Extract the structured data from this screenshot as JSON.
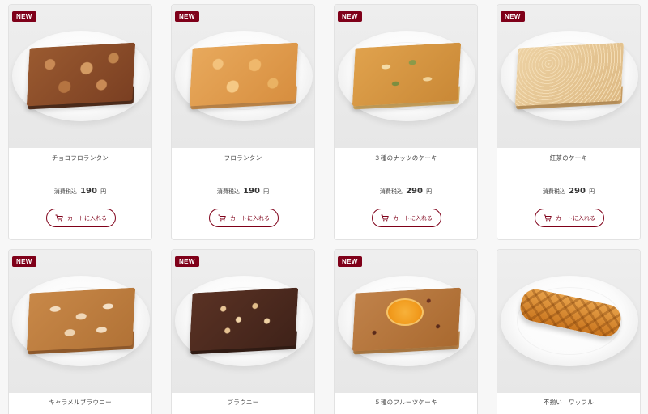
{
  "badge_label": "NEW",
  "price_prefix": "消費税込",
  "price_unit": "円",
  "cart_label": "カートに入れる",
  "accent_color": "#7f0019",
  "products": [
    {
      "name": "チョコフロランタン",
      "price": "190",
      "new": true
    },
    {
      "name": "フロランタン",
      "price": "190",
      "new": true
    },
    {
      "name": "３種のナッツのケーキ",
      "price": "290",
      "new": true
    },
    {
      "name": "紅茶のケーキ",
      "price": "290",
      "new": true
    },
    {
      "name": "キャラメルブラウニー",
      "new": true
    },
    {
      "name": "ブラウニー",
      "new": true
    },
    {
      "name": "５種のフルーツケーキ",
      "new": true
    },
    {
      "name": "不揃い　ワッフル",
      "new": false
    }
  ],
  "icons": {
    "cart": "cart-icon"
  }
}
